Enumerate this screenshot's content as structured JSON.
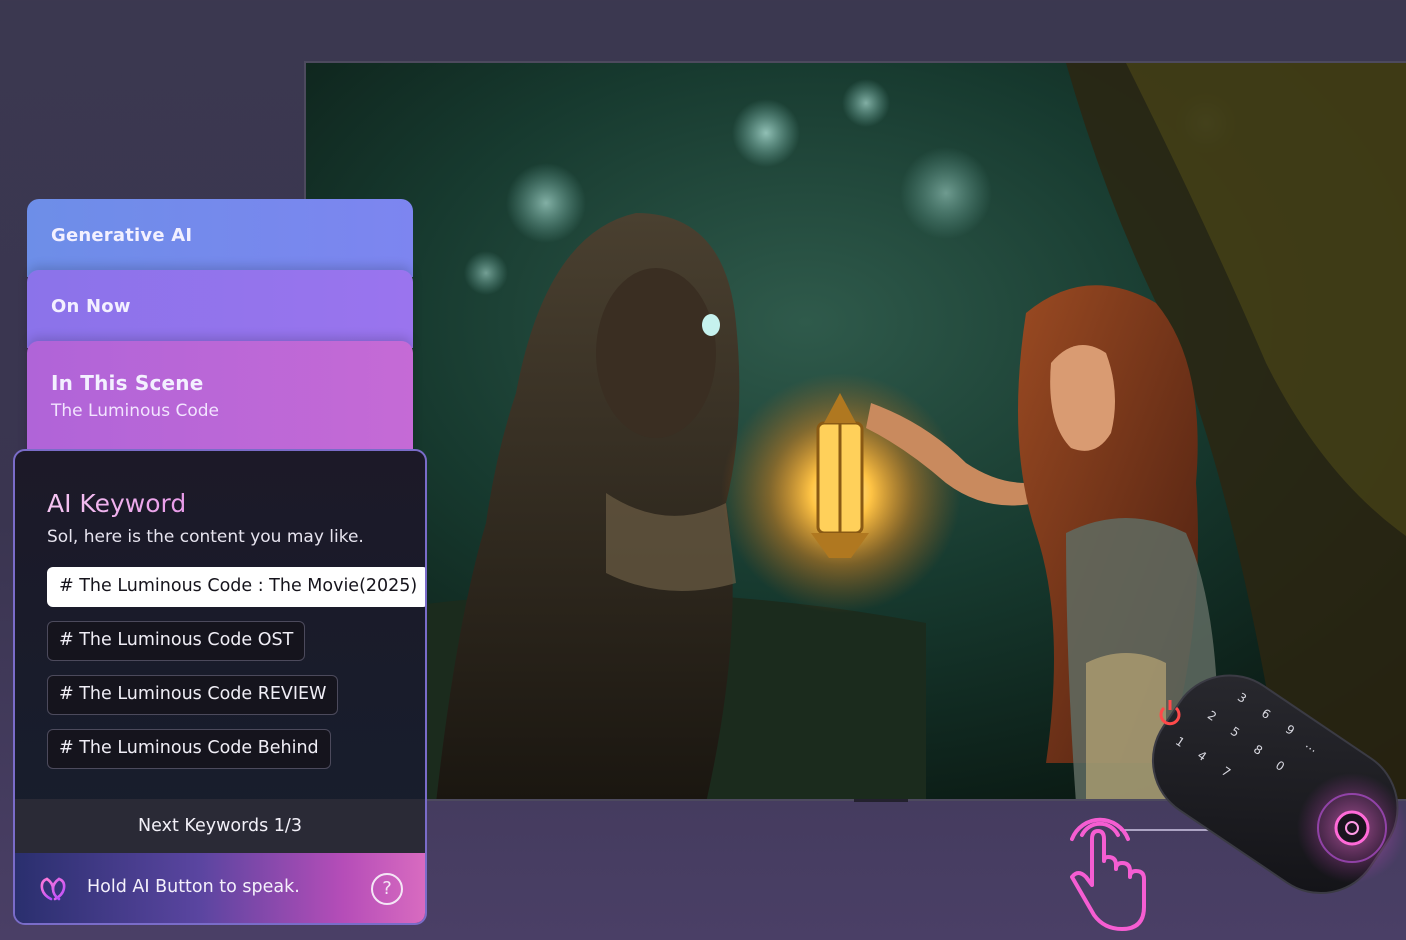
{
  "tabs": [
    {
      "title": "Generative AI"
    },
    {
      "title": "On Now"
    },
    {
      "title": "In This Scene",
      "subtitle": "The Luminous Code"
    }
  ],
  "card": {
    "title": "AI Keyword",
    "subtitle": "Sol, here is the content you may like.",
    "keywords": [
      {
        "label": "# The Luminous Code : The Movie(2025)",
        "selected": true
      },
      {
        "label": "# The Luminous Code  OST",
        "selected": false
      },
      {
        "label": "# The Luminous Code  REVIEW",
        "selected": false
      },
      {
        "label": "# The Luminous Code  Behind",
        "selected": false
      }
    ],
    "next_label": "Next Keywords 1/3",
    "footer_text": "Hold AI Button to speak.",
    "help_symbol": "?"
  },
  "icons": {
    "ai": "ai-assistant-icon",
    "help": "question-mark-icon",
    "hand": "touch-hand-icon"
  },
  "remote": {
    "keys": [
      "1",
      "2",
      "3",
      "4",
      "5",
      "6",
      "7",
      "8",
      "9",
      "0",
      "…"
    ]
  },
  "colors": {
    "accent_pink": "#e89ae8",
    "panel_border": "#7a6cc9",
    "tab_blue": "#6d8ee8",
    "tab_violet": "#8b73ea",
    "tab_magenta": "#b064d8"
  }
}
